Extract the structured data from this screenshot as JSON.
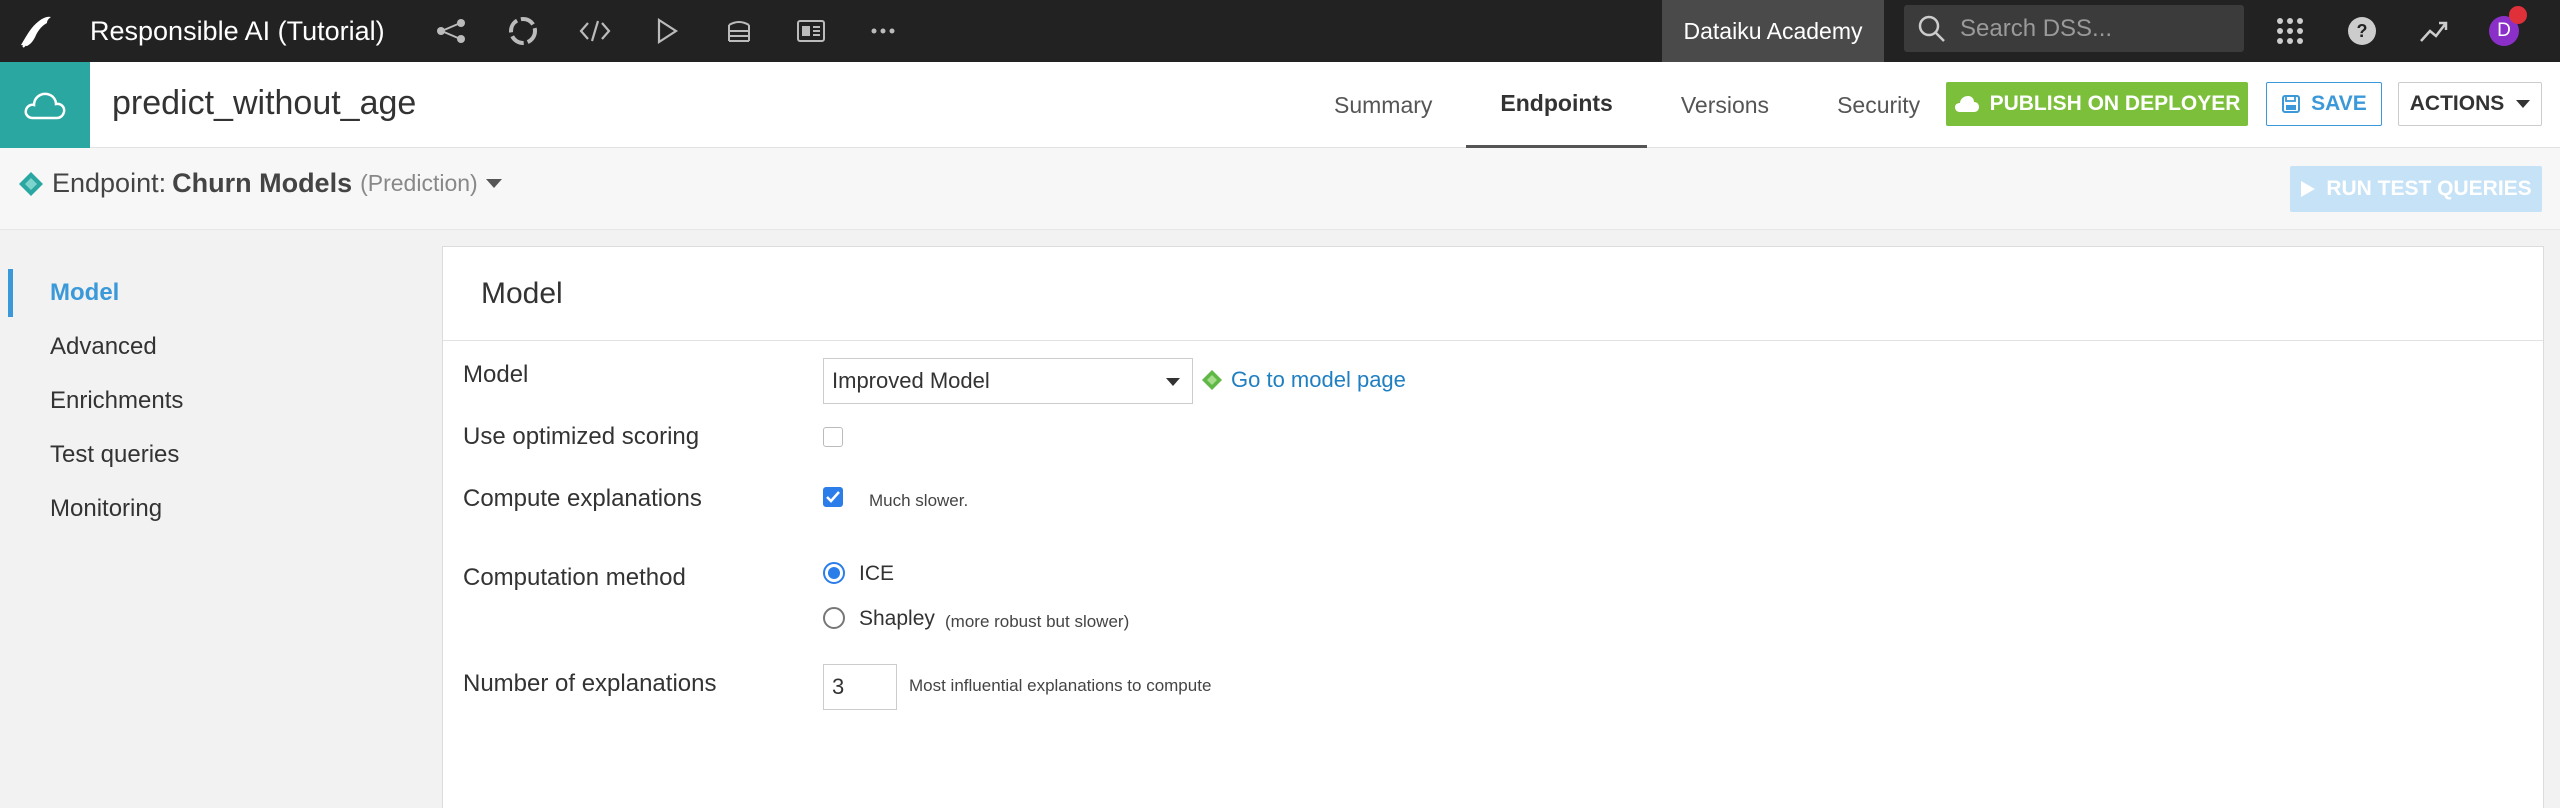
{
  "app": {
    "project_title": "Responsible AI (Tutorial)",
    "instance_name": "Dataiku Academy",
    "search_placeholder": "Search DSS...",
    "user_initial": "D",
    "icons": [
      "bird-logo-icon",
      "flow-icon",
      "lifecycle-icon",
      "code-icon",
      "play-icon",
      "stack-icon",
      "dashboard-icon",
      "more-icon",
      "apps-grid-icon",
      "help-icon",
      "trend-icon"
    ]
  },
  "header": {
    "service_name": "predict_without_age",
    "tabs": [
      "Summary",
      "Endpoints",
      "Versions",
      "Security"
    ],
    "active_tab": "Endpoints",
    "publish_label": "PUBLISH ON DEPLOYER",
    "save_label": "SAVE",
    "actions_label": "ACTIONS"
  },
  "endpoint": {
    "label": "Endpoint:",
    "name": "Churn Models",
    "type": "(Prediction)",
    "run_label": "RUN TEST QUERIES"
  },
  "sidebar": {
    "items": [
      "Model",
      "Advanced",
      "Enrichments",
      "Test queries",
      "Monitoring"
    ],
    "active": "Model"
  },
  "panel": {
    "title": "Model",
    "model_label": "Model",
    "model_value": "Improved Model",
    "model_link": "Go to model page",
    "optimized_label": "Use optimized scoring",
    "optimized_checked": false,
    "explanations_label": "Compute explanations",
    "explanations_checked": true,
    "explanations_hint": "Much slower.",
    "method_label": "Computation method",
    "method_options": [
      {
        "label": "ICE",
        "hint": "",
        "selected": true
      },
      {
        "label": "Shapley",
        "hint": "(more robust but slower)",
        "selected": false
      }
    ],
    "num_label": "Number of explanations",
    "num_value": "3",
    "num_hint": "Most influential explanations to compute"
  },
  "colors": {
    "topbar": "#222222",
    "teal": "#2aa7a0",
    "green": "#7cbf3a",
    "blue": "#3b99d9",
    "checkbox_blue": "#2b7de9"
  }
}
